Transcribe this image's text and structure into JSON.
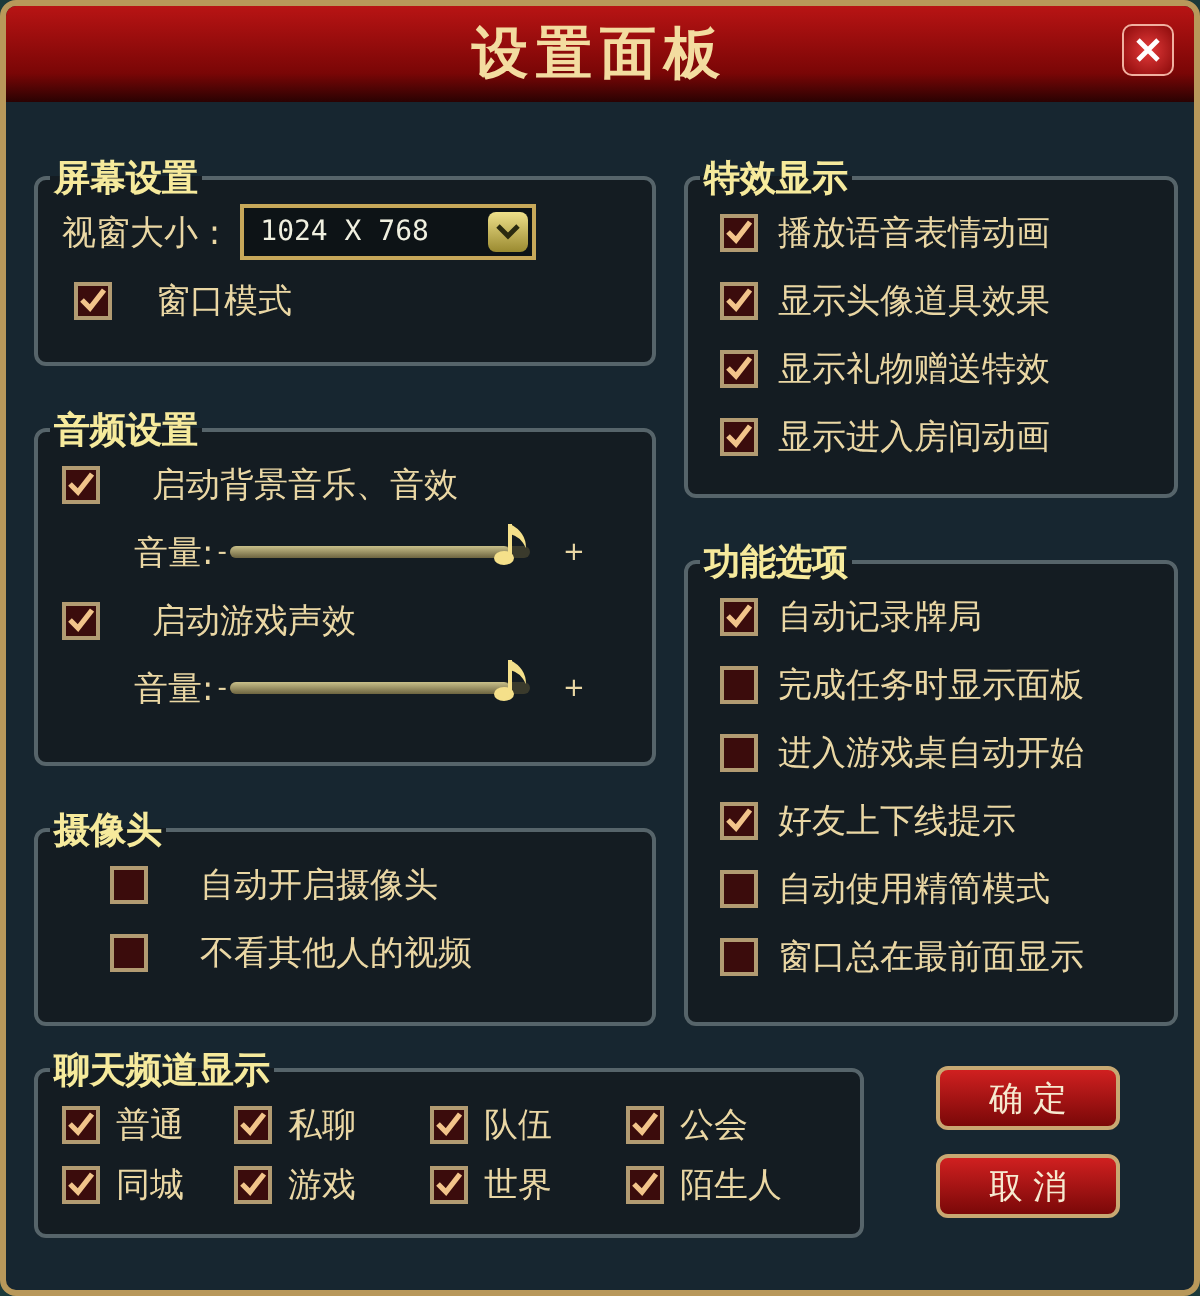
{
  "window": {
    "title": "设置面板"
  },
  "screen": {
    "title": "屏幕设置",
    "resolution_label": "视窗大小 :",
    "resolution": "1024 X 768",
    "options": [
      {
        "label": "窗口模式",
        "checked": true
      }
    ]
  },
  "audio": {
    "title": "音频设置",
    "channels": [
      {
        "label": "启动背景音乐、音效",
        "checked": true,
        "volume_label": "音量:",
        "minus": "-",
        "plus": "+",
        "level": 0.93
      },
      {
        "label": "启动游戏声效",
        "checked": true,
        "volume_label": "音量:",
        "minus": "-",
        "plus": "+",
        "level": 0.93
      }
    ]
  },
  "camera": {
    "title": "摄像头",
    "options": [
      {
        "label": "自动开启摄像头",
        "checked": false
      },
      {
        "label": "不看其他人的视频",
        "checked": false
      }
    ]
  },
  "effects": {
    "title": "特效显示",
    "options": [
      {
        "label": "播放语音表情动画",
        "checked": true
      },
      {
        "label": "显示头像道具效果",
        "checked": true
      },
      {
        "label": "显示礼物赠送特效",
        "checked": true
      },
      {
        "label": "显示进入房间动画",
        "checked": true
      }
    ]
  },
  "functions": {
    "title": "功能选项",
    "options": [
      {
        "label": "自动记录牌局",
        "checked": true
      },
      {
        "label": "完成任务时显示面板",
        "checked": false
      },
      {
        "label": "进入游戏桌自动开始",
        "checked": false
      },
      {
        "label": "好友上下线提示",
        "checked": true
      },
      {
        "label": "自动使用精简模式",
        "checked": false
      },
      {
        "label": "窗口总在最前面显示",
        "checked": false
      }
    ]
  },
  "chat": {
    "title": "聊天频道显示",
    "channels": [
      {
        "label": "普通",
        "checked": true
      },
      {
        "label": "私聊",
        "checked": true
      },
      {
        "label": "队伍",
        "checked": true
      },
      {
        "label": "公会",
        "checked": true
      },
      {
        "label": "同城",
        "checked": true
      },
      {
        "label": "游戏",
        "checked": true
      },
      {
        "label": "世界",
        "checked": true
      },
      {
        "label": "陌生人",
        "checked": true
      }
    ]
  },
  "buttons": [
    "确 定",
    "取 消"
  ]
}
